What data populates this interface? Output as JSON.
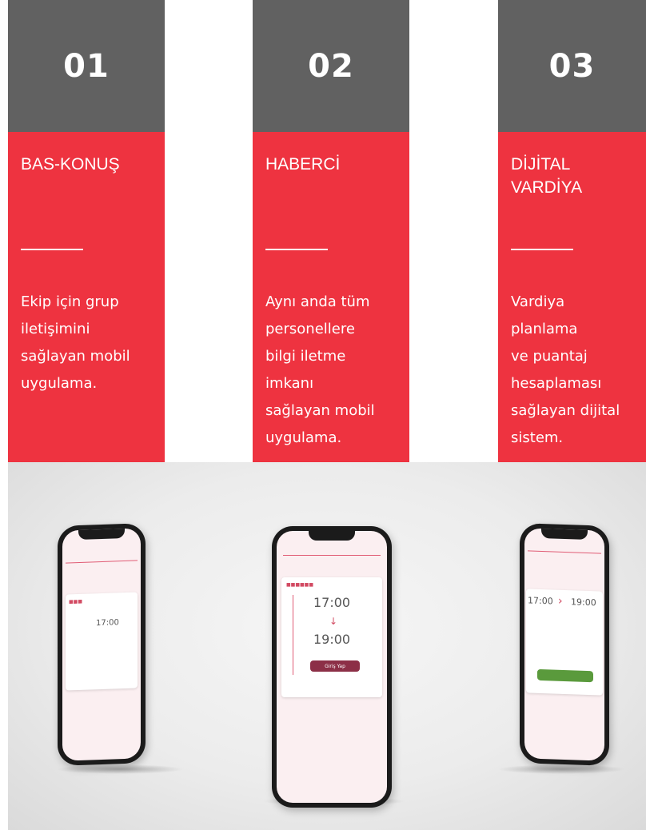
{
  "columns": [
    {
      "number": "01",
      "title": "BAS-KONUŞ",
      "description": "Ekip için grup\niletişimini\nsağlayan mobil\nuygulama."
    },
    {
      "number": "02",
      "title": "HABERCİ",
      "description": "Aynı anda tüm\npersonellere\nbilgi iletme\nimkanı\nsağlayan mobil\nuygulama."
    },
    {
      "number": "03",
      "title": "DİJİTAL\nVARDİYA",
      "description": "Vardiya\nplanlama\nve puantaj\nhesaplaması\nsağlayan dijital\nsistem."
    }
  ],
  "phones": {
    "left": {
      "time": "17:00"
    },
    "center": {
      "start_time": "17:00",
      "arrow": "↓",
      "end_time": "19:00",
      "button_label": "Giriş Yap"
    },
    "right": {
      "start_time": "17:00",
      "arrow": "›",
      "end_time": "19:00"
    }
  },
  "colors": {
    "gray": "#616161",
    "red": "#ee3340",
    "phone_accent": "#d24a62",
    "phone_button": "#8c2f47",
    "green_button": "#5a9a3c"
  }
}
